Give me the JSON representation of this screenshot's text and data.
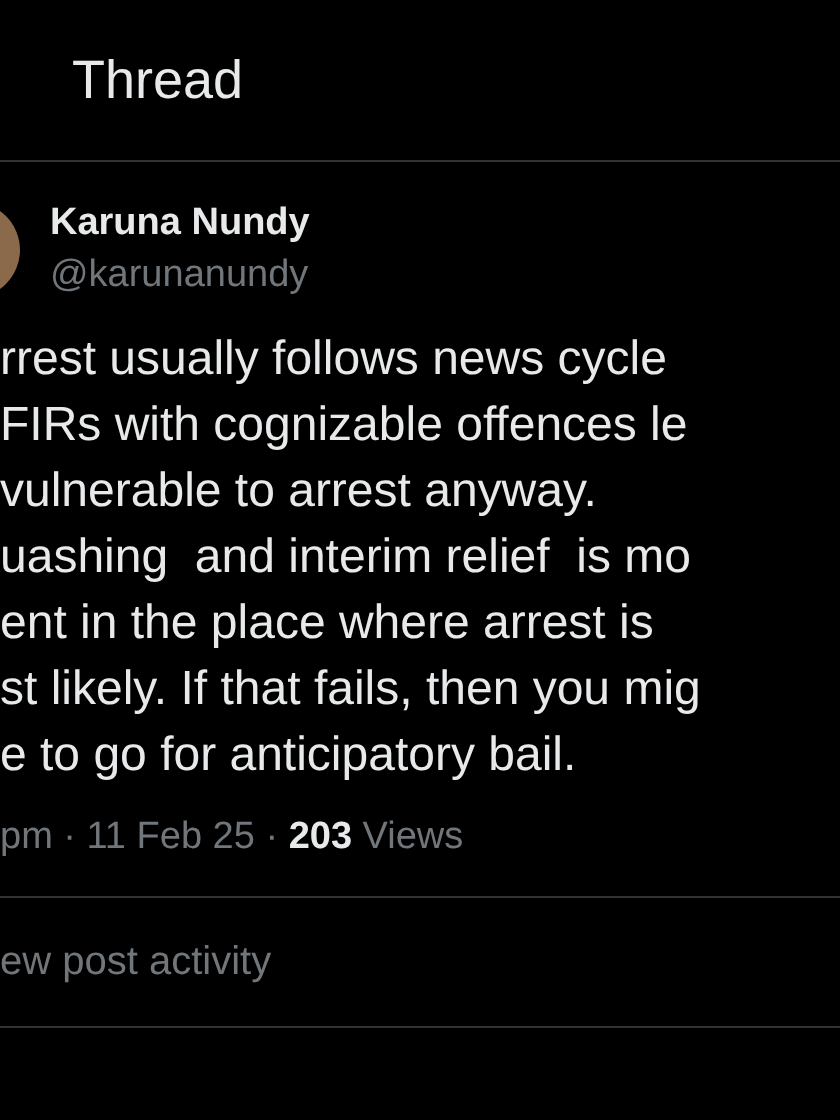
{
  "header": {
    "title": "Thread"
  },
  "post": {
    "author": {
      "name": "Karuna Nundy",
      "handle": "@karunanundy"
    },
    "lines": [
      "rrest usually follows news cycle",
      "FIRs with cognizable offences le",
      "vulnerable to arrest anyway.",
      "uashing  and interim relief  is mo",
      "ent in the place where arrest is",
      "st likely. If that fails, then you mig",
      "e to go for anticipatory bail."
    ],
    "meta": "pm · 11 Feb 25 · **203** Views"
  },
  "activity_link": "ew post activity"
}
